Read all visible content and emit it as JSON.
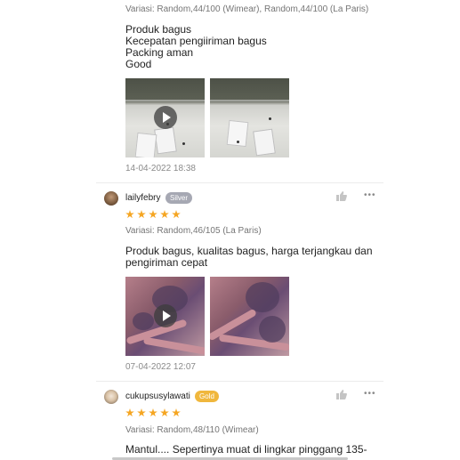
{
  "reviews": [
    {
      "variasi": "Variasi: Random,44/100 (Wimear), Random,44/100 (La Paris)",
      "lines": [
        "Produk bagus",
        "Kecepatan pengiiriman bagus",
        "Packing aman",
        "Good"
      ],
      "media": [
        {
          "type": "video",
          "icon": "play-icon"
        },
        {
          "type": "photo"
        }
      ],
      "date": "14-04-2022 18:38"
    },
    {
      "username": "lailyfebry",
      "badge": "Silver",
      "badge_color": "#a6a8b3",
      "rating": 5,
      "variasi": "Variasi: Random,46/105 (La Paris)",
      "lines": [
        "Produk bagus, kualitas bagus, harga terjangkau dan",
        "pengiriman cepat"
      ],
      "media": [
        {
          "type": "video",
          "icon": "play-icon"
        },
        {
          "type": "photo"
        }
      ],
      "date": "07-04-2022 12:07"
    },
    {
      "username": "cukupsusylawati",
      "badge": "Gold",
      "badge_color": "#f0b73d",
      "rating": 5,
      "variasi": "Variasi: Random,48/110 (Wimear)",
      "lines": [
        "Mantul.... Sepertinya muat di lingkar pinggang 135-"
      ]
    }
  ],
  "actions": {
    "like_icon": "thumbs-up-icon",
    "more_label": "•••",
    "star_color": "#f5a623"
  }
}
